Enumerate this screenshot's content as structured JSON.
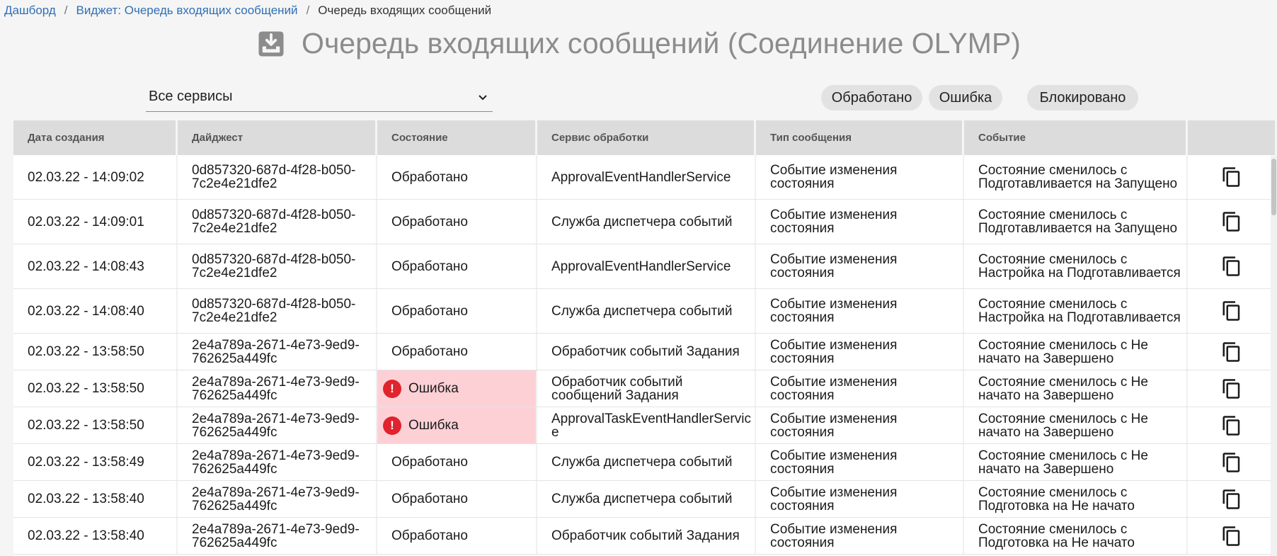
{
  "breadcrumb": {
    "items": [
      "Дашборд",
      "Виджет: Очередь входящих сообщений"
    ],
    "current": "Очередь входящих сообщений"
  },
  "title": "Очередь входящих сообщений (Соединение OLYMP)",
  "title_icon": "inbox-download-icon",
  "service_select": {
    "value": "Все сервисы"
  },
  "status_filters": [
    "Обработано",
    "Ошибка",
    "Блокировано"
  ],
  "table": {
    "columns": [
      "Дата создания",
      "Дайджест",
      "Состояние",
      "Сервис обработки",
      "Тип сообщения",
      "Событие",
      ""
    ],
    "rows": [
      {
        "date": "02.03.22 - 14:09:02",
        "digest": "0d857320-687d-4f28-b050-7c2e4e21dfe2",
        "state": "Обработано",
        "error": false,
        "service": "ApprovalEventHandlerService",
        "type": "Событие изменения состояния",
        "event": "Состояние сменилось с Подготавливается на Запущено"
      },
      {
        "date": "02.03.22 - 14:09:01",
        "digest": "0d857320-687d-4f28-b050-7c2e4e21dfe2",
        "state": "Обработано",
        "error": false,
        "service": "Служба диспетчера событий",
        "type": "Событие изменения состояния",
        "event": "Состояние сменилось с Подготавливается на Запущено"
      },
      {
        "date": "02.03.22 - 14:08:43",
        "digest": "0d857320-687d-4f28-b050-7c2e4e21dfe2",
        "state": "Обработано",
        "error": false,
        "service": "ApprovalEventHandlerService",
        "type": "Событие изменения состояния",
        "event": "Состояние сменилось с Настройка на Подготавливается"
      },
      {
        "date": "02.03.22 - 14:08:40",
        "digest": "0d857320-687d-4f28-b050-7c2e4e21dfe2",
        "state": "Обработано",
        "error": false,
        "service": "Служба диспетчера событий",
        "type": "Событие изменения состояния",
        "event": "Состояние сменилось с Настройка на Подготавливается"
      },
      {
        "date": "02.03.22 - 13:58:50",
        "digest": "2e4a789a-2671-4e73-9ed9-762625a449fc",
        "state": "Обработано",
        "error": false,
        "service": "Обработчик событий Задания",
        "type": "Событие изменения состояния",
        "event": "Состояние сменилось с Не начато на Завершено"
      },
      {
        "date": "02.03.22 - 13:58:50",
        "digest": "2e4a789a-2671-4e73-9ed9-762625a449fc",
        "state": "Ошибка",
        "error": true,
        "service": "Обработчик событий сообщений Задания",
        "type": "Событие изменения состояния",
        "event": "Состояние сменилось с Не начато на Завершено"
      },
      {
        "date": "02.03.22 - 13:58:50",
        "digest": "2e4a789a-2671-4e73-9ed9-762625a449fc",
        "state": "Ошибка",
        "error": true,
        "service": "ApprovalTaskEventHandlerService",
        "type": "Событие изменения состояния",
        "event": "Состояние сменилось с Не начато на Завершено"
      },
      {
        "date": "02.03.22 - 13:58:49",
        "digest": "2e4a789a-2671-4e73-9ed9-762625a449fc",
        "state": "Обработано",
        "error": false,
        "service": "Служба диспетчера событий",
        "type": "Событие изменения состояния",
        "event": "Состояние сменилось с Не начато на Завершено"
      },
      {
        "date": "02.03.22 - 13:58:40",
        "digest": "2e4a789a-2671-4e73-9ed9-762625a449fc",
        "state": "Обработано",
        "error": false,
        "service": "Служба диспетчера событий",
        "type": "Событие изменения состояния",
        "event": "Состояние сменилось с Подготовка на Не начато"
      },
      {
        "date": "02.03.22 - 13:58:40",
        "digest": "2e4a789a-2671-4e73-9ed9-762625a449fc",
        "state": "Обработано",
        "error": false,
        "service": "Обработчик событий Задания",
        "type": "Событие изменения состояния",
        "event": "Состояние сменилось с Подготовка на Не начато"
      }
    ]
  },
  "colors": {
    "link": "#2f6fb5",
    "error_bg": "#fdd0d6",
    "error_icon": "#e0232d",
    "header_bg": "#dcdcdc"
  }
}
